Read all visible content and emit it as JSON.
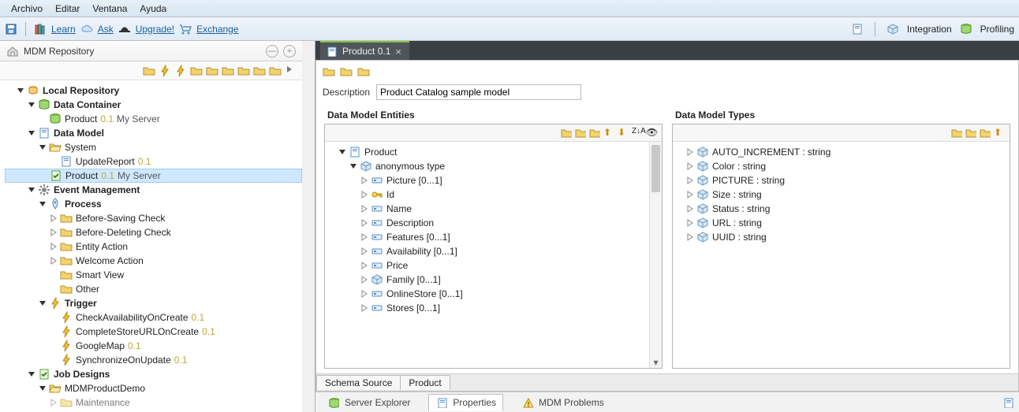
{
  "menu": {
    "file": "Archivo",
    "edit": "Editar",
    "window": "Ventana",
    "help": "Ayuda"
  },
  "toolbar": {
    "learn": "Learn",
    "ask": "Ask",
    "upgrade": "Upgrade!",
    "exchange": "Exchange",
    "integration": "Integration",
    "profiling": "Profiling"
  },
  "repoView": {
    "title": "MDM Repository"
  },
  "tree": {
    "local": "Local Repository",
    "dataContainer": "Data Container",
    "dcProduct": "Product",
    "dcProductVer": "0.1",
    "dcProductSrv": "My Server",
    "dataModel": "Data Model",
    "system": "System",
    "updateReport": "UpdateReport",
    "updateReportVer": "0.1",
    "dmProduct": "Product",
    "dmProductVer": "0.1",
    "dmProductSrv": "My Server",
    "eventMgmt": "Event Management",
    "process": "Process",
    "beforeSaving": "Before-Saving Check",
    "beforeDeleting": "Before-Deleting Check",
    "entityAction": "Entity Action",
    "welcomeAction": "Welcome Action",
    "smartView": "Smart View",
    "other": "Other",
    "trigger": "Trigger",
    "trg1": "CheckAvailabilityOnCreate",
    "trg1v": "0.1",
    "trg2": "CompleteStoreURLOnCreate",
    "trg2v": "0.1",
    "trg3": "GoogleMap",
    "trg3v": "0.1",
    "trg4": "SynchronizeOnUpdate",
    "trg4v": "0.1",
    "jobDesigns": "Job Designs",
    "mdmDemo": "MDMProductDemo",
    "maintenance": "Maintenance"
  },
  "editor": {
    "tabTitle": "Product 0.1",
    "descLabel": "Description",
    "descValue": "Product Catalog sample model",
    "entitiesTitle": "Data Model Entities",
    "typesTitle": "Data Model Types",
    "bottomTabs": {
      "schema": "Schema Source",
      "product": "Product"
    }
  },
  "entities": {
    "root": "Product",
    "anon": "anonymous type",
    "picture": "Picture  [0...1]",
    "id": "Id",
    "name": "Name",
    "description": "Description",
    "features": "Features  [0...1]",
    "availability": "Availability  [0...1]",
    "price": "Price",
    "family": "Family  [0...1]",
    "onlineStore": "OnlineStore  [0...1]",
    "stores": "Stores  [0...1]"
  },
  "types": {
    "t1": "AUTO_INCREMENT : string",
    "t2": "Color : string",
    "t3": "PICTURE : string",
    "t4": "Size : string",
    "t5": "Status : string",
    "t6": "URL : string",
    "t7": "UUID : string"
  },
  "views": {
    "serverExplorer": "Server Explorer",
    "properties": "Properties",
    "mdmProblems": "MDM Problems"
  }
}
